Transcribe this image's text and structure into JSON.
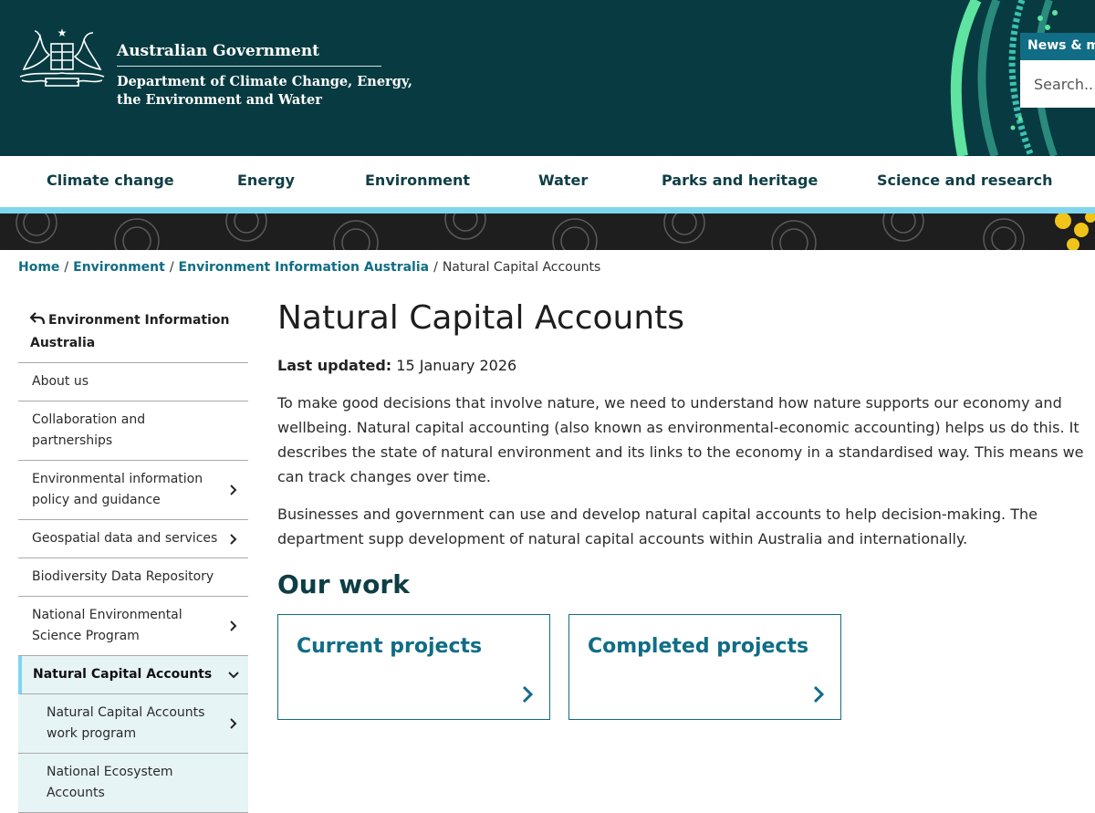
{
  "header": {
    "gov_name": "Australian Government",
    "dept_line1": "Department of Climate Change, Energy,",
    "dept_line2": "the Environment and Water",
    "news_tab": "News & me",
    "search_placeholder": "Search..."
  },
  "nav": {
    "items": [
      "Climate change",
      "Energy",
      "Environment",
      "Water",
      "Parks and heritage",
      "Science and research"
    ]
  },
  "breadcrumb": {
    "items": [
      "Home",
      "Environment",
      "Environment Information Australia"
    ],
    "current": "Natural Capital Accounts",
    "separator": "/"
  },
  "sidebar": {
    "parent": "Environment Information Australia",
    "items": [
      "About us",
      "Collaboration and partnerships",
      "Environmental information policy and guidance",
      "Geospatial data and services",
      "Biodiversity Data Repository",
      "National Environmental Science Program",
      "Natural Capital Accounts",
      "Natural Capital Accounts work program",
      "National Ecosystem Accounts"
    ]
  },
  "content": {
    "title": "Natural Capital Accounts",
    "updated_label": "Last updated:",
    "updated_date": "15 January 2026",
    "para1": "To make good decisions that involve nature, we need to understand how nature supports our economy and wellbeing. Natural capital accounting (also known as environmental-economic accounting) helps us do this. It describes the state of natural environment and its links to the economy in a standardised way. This means we can track changes over time.",
    "para2": "Businesses and government can use and develop natural capital accounts to help decision-making. The department supp development of natural capital accounts within Australia and internationally.",
    "section_title": "Our work",
    "cards": [
      "Current projects",
      "Completed projects"
    ]
  },
  "colors": {
    "header_bg": "#073b41",
    "link": "#106d85",
    "heading": "#0e3e45",
    "accent_stripe": "#7fd6ee",
    "active_bg": "#e6f4f6"
  }
}
